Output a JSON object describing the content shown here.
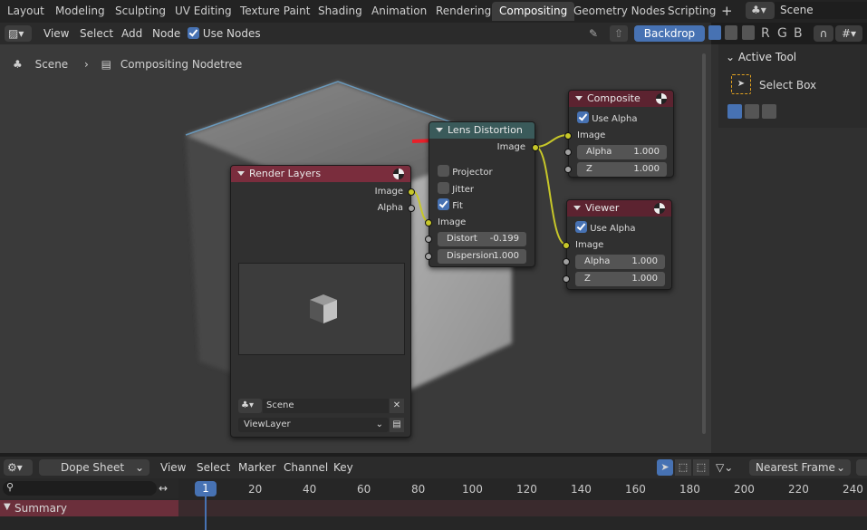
{
  "topbar": {
    "tabs": [
      "Layout",
      "Modeling",
      "Sculpting",
      "UV Editing",
      "Texture Paint",
      "Shading",
      "Animation",
      "Rendering",
      "Compositing",
      "Geometry Nodes",
      "Scripting"
    ],
    "active_tab": "Compositing",
    "add_tab": "+",
    "scene": "Scene"
  },
  "header": {
    "menus": [
      "View",
      "Select",
      "Add",
      "Node"
    ],
    "use_nodes": "Use Nodes",
    "backdrop": "Backdrop",
    "channels": [
      "R",
      "G",
      "B"
    ]
  },
  "breadcrumb": {
    "scene": "Scene",
    "tree": "Compositing Nodetree"
  },
  "sidebar": {
    "section": "Active Tool",
    "tool": "Select Box"
  },
  "nodes": {
    "render_layers": {
      "title": "Render Layers",
      "out_image": "Image",
      "out_alpha": "Alpha",
      "scene": "Scene",
      "view_layer": "ViewLayer",
      "color": "#7a2d3d"
    },
    "lens_distortion": {
      "title": "Lens Distortion",
      "out_image": "Image",
      "projector": "Projector",
      "jitter": "Jitter",
      "fit": "Fit",
      "in_image": "Image",
      "distort_label": "Distort",
      "distort_value": "-0.199",
      "dispersion_label": "Dispersion",
      "dispersion_value": "1.000",
      "color": "#3a5a5a"
    },
    "composite": {
      "title": "Composite",
      "use_alpha": "Use Alpha",
      "in_image": "Image",
      "alpha_label": "Alpha",
      "alpha_value": "1.000",
      "z_label": "Z",
      "z_value": "1.000",
      "color": "#5c2330"
    },
    "viewer": {
      "title": "Viewer",
      "use_alpha": "Use Alpha",
      "in_image": "Image",
      "alpha_label": "Alpha",
      "alpha_value": "1.000",
      "z_label": "Z",
      "z_value": "1.000",
      "color": "#5c2330"
    }
  },
  "dopesheet": {
    "editor": "Dope Sheet",
    "menus": [
      "View",
      "Select",
      "Marker",
      "Channel",
      "Key"
    ],
    "snap": "Nearest Frame",
    "current_frame": "1",
    "ticks": [
      "20",
      "40",
      "60",
      "80",
      "100",
      "120",
      "140",
      "160",
      "180",
      "200",
      "220",
      "240"
    ],
    "summary": "Summary"
  }
}
